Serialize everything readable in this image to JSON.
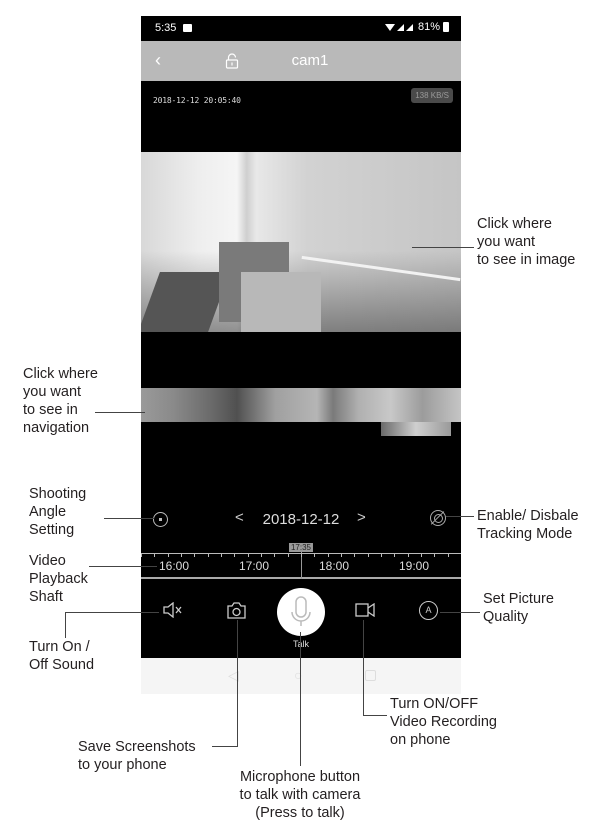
{
  "status_bar": {
    "time": "5:35",
    "battery": "81%"
  },
  "header": {
    "back_icon": "chevron-left-icon",
    "lock_icon": "lock-icon",
    "title": "cam1"
  },
  "video": {
    "osd_timestamp": "2018-12-12 20:05:40",
    "bitrate": "138 KB/S"
  },
  "playback": {
    "date": "2018-12-12",
    "prev_label": "<",
    "next_label": ">",
    "cursor_time": "17:35",
    "hours": [
      "16:00",
      "17:00",
      "18:00",
      "19:00"
    ]
  },
  "toolbar": {
    "sound_icon": "speaker-mute-icon",
    "snapshot_icon": "camera-icon",
    "talk_icon": "microphone-icon",
    "talk_label": "Talk",
    "record_icon": "video-camera-icon",
    "quality_label": "A"
  },
  "android_nav": {
    "back": "◁",
    "home": "○"
  },
  "annotations": {
    "image_tap": "Click where\nyou want\nto see in image",
    "nav_tap": "Click where\nyou want\nto see in\nnavigation",
    "angle": "Shooting\nAngle\nSetting",
    "tracking": "Enable/ Disbale\nTracking Mode",
    "shaft": "Video\nPlayback\nShaft",
    "quality": "Set Picture\nQuality",
    "sound": "Turn On /\nOff Sound",
    "recording": "Turn ON/OFF\nVideo Recording\non phone",
    "screenshot": "Save Screenshots\nto your phone",
    "microphone": "Microphone button\nto talk with camera\n(Press to talk)"
  }
}
